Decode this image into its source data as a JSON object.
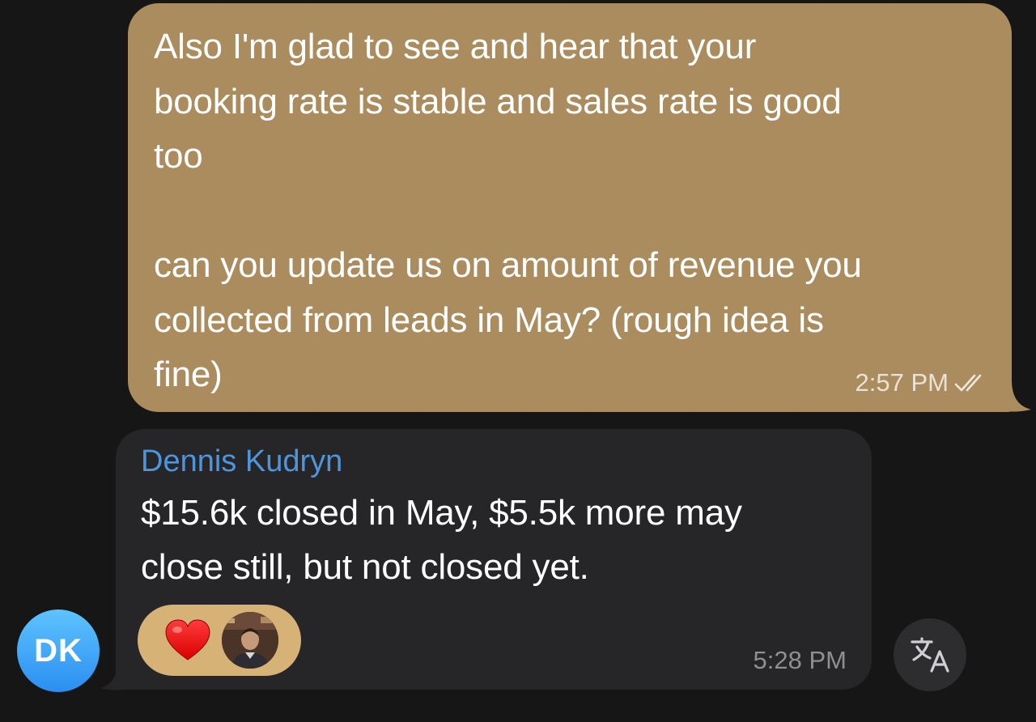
{
  "outgoing_message": {
    "text": "Also I'm glad to see and hear that your\nbooking rate is stable and sales rate is good\ntoo\n\ncan you update us on amount of revenue you\ncollected from leads in May? (rough idea is\nfine)",
    "time": "2:57 PM",
    "status_icon": "double-check-icon",
    "bubble_color": "#aa8c5e"
  },
  "incoming_message": {
    "sender": "Dennis Kudryn",
    "sender_color": "#4f95db",
    "text": "$15.6k closed in May, $5.5k more may\nclose still, but not closed yet.",
    "time": "5:28 PM",
    "reactions": [
      {
        "emoji": "❤️",
        "icon": "heart-icon"
      },
      {
        "type": "avatar",
        "icon": "reactor-avatar"
      }
    ],
    "bubble_color": "#262628"
  },
  "sender_avatar": {
    "initials": "DK",
    "color": "#2a8ff0"
  },
  "translate_button": {
    "icon": "translate-icon"
  }
}
